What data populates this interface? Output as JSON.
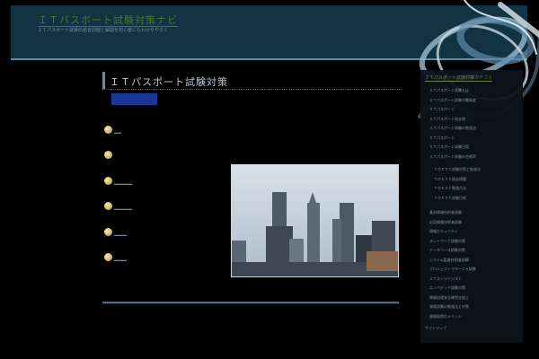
{
  "header": {
    "site_title": "ＩＴパスポート試験対策ナビ",
    "tagline": "ＩＴパスポート試験の過去問題と解説を初心者にもわかりやすく"
  },
  "main": {
    "page_heading": "ＩＴパスポート試験対策",
    "list_items": [
      "____",
      "",
      "__________",
      "__________",
      "_______",
      "_______"
    ]
  },
  "sidebar": {
    "title": "ＩＴパスポート試験対策カテゴリ",
    "groups": [
      [
        "ＩＴパスポート試験とは",
        "ＩＴパスポート試験の難易度",
        "ＩＴパスポート",
        "ＩＴパスポート過去問",
        "ＩＴパスポート試験の勉強法",
        "ＩＴパスポート",
        "ＩＴパスポート試験日程",
        "ＩＴパスポート試験の合格率"
      ],
      [
        "ＴＯＥＩＣ試験対策と勉強法",
        "ＴＯＥＩＣ過去問題",
        "ＴＯＥＩＣ勉強方法",
        "ＴＯＥＩＣ試験日程"
      ],
      [
        "基本情報技術者試験",
        "応用情報技術者試験",
        "情報セキュリティ",
        "ネットワーク試験対策",
        "データベース試験対策",
        "システム監査技術者試験",
        "プロジェクトマネージャ試験",
        "ＩＴストラテジスト",
        "エンベデッド試験対策",
        "情報処理安全確保支援士",
        "資格試験の勉強法と対策",
        "資格取得のメリット"
      ]
    ],
    "footer": "サイトマップ"
  }
}
